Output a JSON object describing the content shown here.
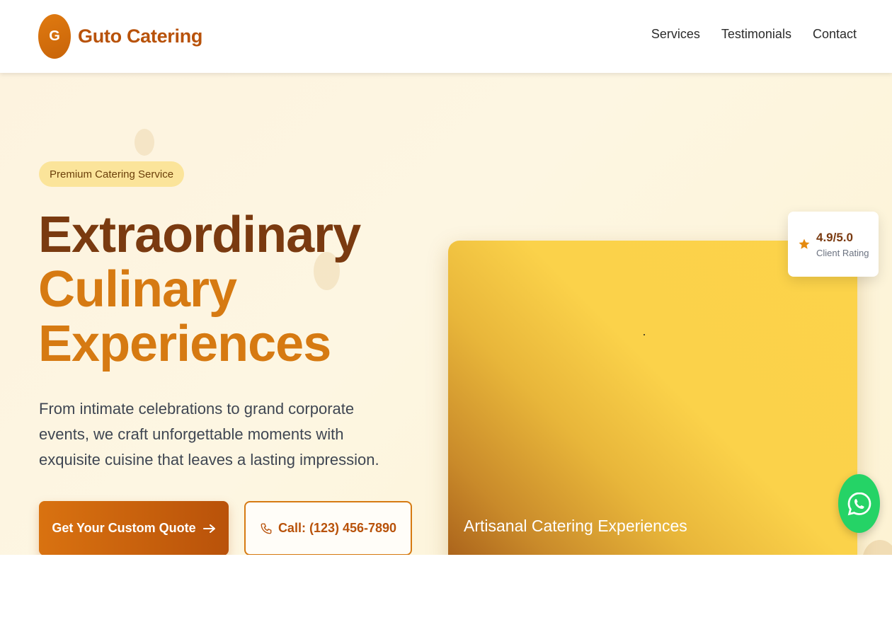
{
  "brand": {
    "logo_letter": "G",
    "name": "Guto Catering"
  },
  "nav": {
    "items": [
      "Services",
      "Testimonials",
      "Contact"
    ]
  },
  "hero": {
    "badge": "Premium Catering Service",
    "headline_line1": "Extraordinary",
    "headline_line2": "Culinary",
    "headline_line3": "Experiences",
    "description": "From intimate celebrations to grand corporate events, we craft unforgettable moments with exquisite cuisine that leaves a lasting impression.",
    "primary_button": "Get Your Custom Quote",
    "primary_button_icon": "arrow-right-icon",
    "secondary_button": "Call: (123) 456-7890",
    "secondary_button_icon": "phone-icon"
  },
  "card": {
    "caption": "Artisanal Catering Experiences"
  },
  "rating": {
    "value": "4.9/5.0",
    "label": "Client Rating",
    "icon": "star-icon"
  },
  "whatsapp": {
    "icon": "whatsapp-icon"
  },
  "colors": {
    "brand_dark": "#7a3a10",
    "brand_accent": "#d67a12",
    "badge_bg": "#fbe49a",
    "whatsapp": "#25d366"
  }
}
